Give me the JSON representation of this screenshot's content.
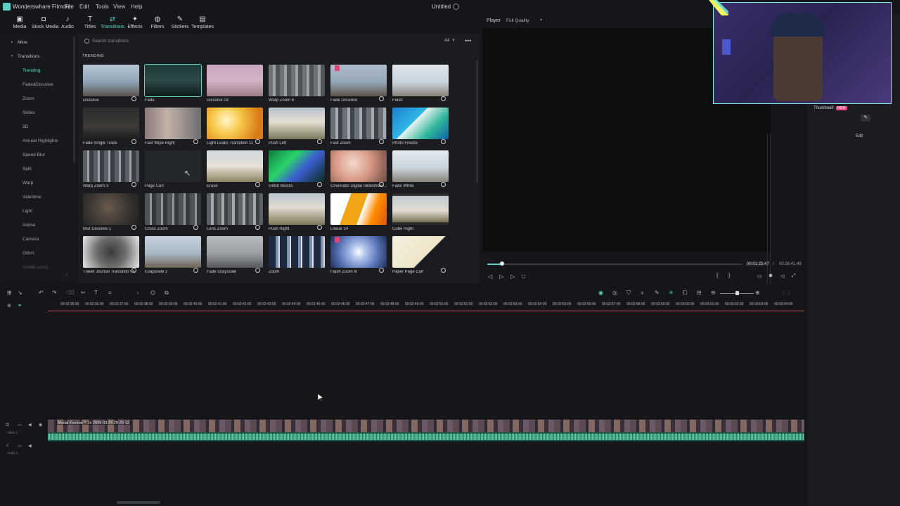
{
  "app": {
    "title": "Wonderswhare Filmora",
    "doc_title": "Untitled"
  },
  "menu": [
    "File",
    "Edit",
    "Tools",
    "View",
    "Help"
  ],
  "toolbar": [
    {
      "label": "Media",
      "icon": "media-icon",
      "glyph": "▣"
    },
    {
      "label": "Stock Media",
      "icon": "stock-media-icon",
      "glyph": "◘"
    },
    {
      "label": "Audio",
      "icon": "audio-icon",
      "glyph": "♪"
    },
    {
      "label": "Titles",
      "icon": "titles-icon",
      "glyph": "T"
    },
    {
      "label": "Transitions",
      "icon": "transitions-icon",
      "glyph": "⇄",
      "active": true
    },
    {
      "label": "Effects",
      "icon": "effects-icon",
      "glyph": "✦"
    },
    {
      "label": "Filters",
      "icon": "filters-icon",
      "glyph": "◍"
    },
    {
      "label": "Stickers",
      "icon": "stickers-icon",
      "glyph": "✎"
    },
    {
      "label": "Templates",
      "icon": "templates-icon",
      "glyph": "▤"
    }
  ],
  "sidebar": {
    "mine": "Mine",
    "transitions": "Transitions",
    "items": [
      "Trending",
      "Fade&Dissolve",
      "Zoom",
      "Slides",
      "3D",
      "Annual Highlights",
      "Speed Blur",
      "Split",
      "Warp",
      "Valentine",
      "Light",
      "Anime",
      "Camera",
      "Glitch",
      "Grid&Luxury"
    ],
    "active_index": 0
  },
  "library": {
    "search_placeholder": "Search transitions",
    "filter": "All",
    "section": "TRENDING",
    "tiles": [
      [
        "Dissolve",
        "Fade",
        "Dissolve 03",
        "Warp Zoom 6",
        "Fade Dissolve",
        "Flash"
      ],
      [
        "Fade Single Track",
        "Fast Wipe Right",
        "Light Leaks Transition 11",
        "Push Left",
        "Fast Zoom",
        "Photo Freeze"
      ],
      [
        "Warp Zoom 3",
        "Page Curl",
        "Erase",
        "Glitch Blocks",
        "Cinematic Digital Slideshow ...",
        "Fade White"
      ],
      [
        "Blur Dissolve 1",
        "Cross Zoom",
        "Lens Zoom",
        "Push Right",
        "Linear 14",
        "Cube Right"
      ],
      [
        "Travel Journal Transition 05",
        "Evaporate 2",
        "Fade Grayscale",
        "Zoom",
        "Flash Zoom In",
        "Paper Page Curl"
      ]
    ],
    "selected": "Fade"
  },
  "player": {
    "label": "Player",
    "quality": "Full Quality",
    "current_time": "00:01:25:47",
    "separator": "/",
    "total_time": "00:26:41:49",
    "progress": 0.06
  },
  "right_panel": {
    "thumbnail_label": "Thumbnail:",
    "new_badge": "NEW",
    "edit_label": "Edit"
  },
  "timeline": {
    "ruler": [
      "00:02:35:00",
      "00:02:36:00",
      "00:02:37:00",
      "00:02:38:00",
      "00:02:39:00",
      "00:02:40:00",
      "00:02:41:00",
      "00:02:42:00",
      "00:02:43:00",
      "00:02:44:00",
      "00:02:45:00",
      "00:02:46:00",
      "00:02:47:00",
      "00:02:48:00",
      "00:02:49:00",
      "00:02:50:00",
      "00:02:51:00",
      "00:02:52:00",
      "00:02:53:00",
      "00:02:54:00",
      "00:02:55:00",
      "00:02:56:00",
      "00:02:57:00",
      "00:02:58:00",
      "00:02:59:00",
      "00:03:00:00",
      "00:03:01:00",
      "00:03:02:00",
      "00:03:03:00",
      "00:03:04:00"
    ],
    "video_clip": "Mortal Kombat™ 1v 2026-03-29 20-20-13",
    "video_track": "Video 1",
    "audio_track": "Audio 1"
  },
  "colors": {
    "accent": "#5fd4c4",
    "playhead": "#d94f65",
    "webcam_border": "#7cf2e6"
  }
}
